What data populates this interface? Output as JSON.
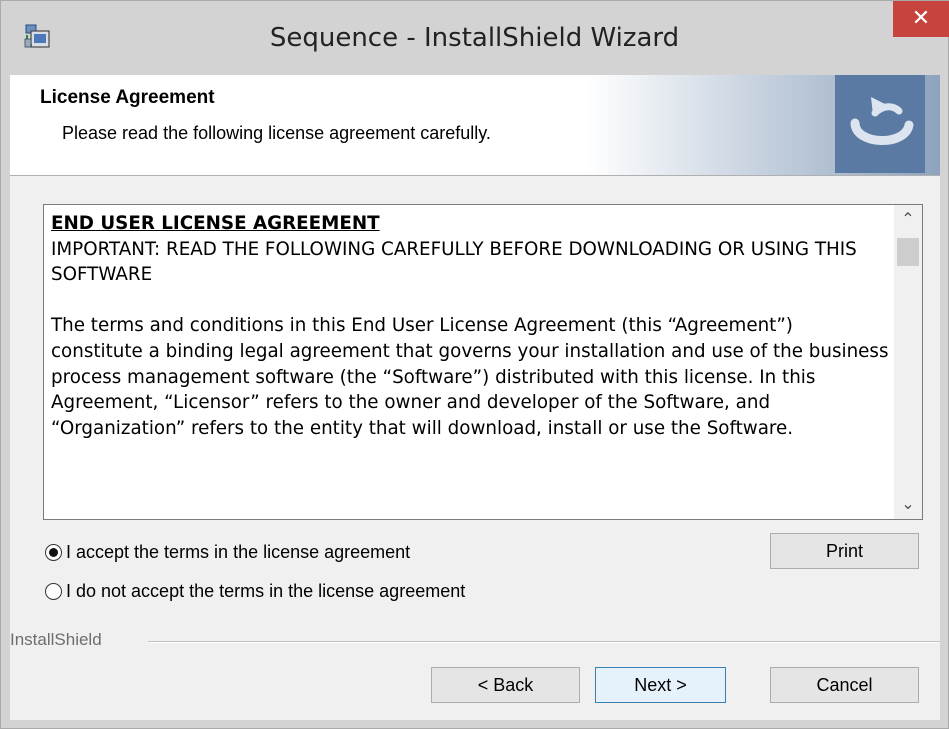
{
  "window": {
    "title": "Sequence - InstallShield Wizard",
    "close_glyph": "✕"
  },
  "header": {
    "title": "License Agreement",
    "subtitle": "Please read the following license agreement carefully."
  },
  "license": {
    "heading": "END USER LICENSE AGREEMENT",
    "important": "IMPORTANT: READ THE FOLLOWING CAREFULLY BEFORE DOWNLOADING OR USING THIS SOFTWARE",
    "body": "The terms and conditions in this End User License Agreement (this “Agreement”) constitute a binding legal agreement that governs your installation and use of the business process management software (the “Software”) distributed with this license. In this Agreement, “Licensor” refers to the owner and developer of the Software, and “Organization” refers to the entity that will download, install or use the Software."
  },
  "scrollbar": {
    "up_glyph": "⌃",
    "down_glyph": "⌄"
  },
  "options": {
    "accept_label": "I accept the terms in the license agreement",
    "decline_label": "I do not accept the terms in the license agreement",
    "selected": "accept"
  },
  "buttons": {
    "print": "Print",
    "back": "< Back",
    "next": "Next >",
    "cancel": "Cancel"
  },
  "footer": {
    "brand": "InstallShield"
  },
  "colors": {
    "close_button": "#c7443e",
    "header_logo": "#5a7aa4",
    "default_button_border": "#3c7fb1"
  },
  "icons": {
    "app": "installer-icon",
    "logo": "installshield-swirl-icon"
  }
}
